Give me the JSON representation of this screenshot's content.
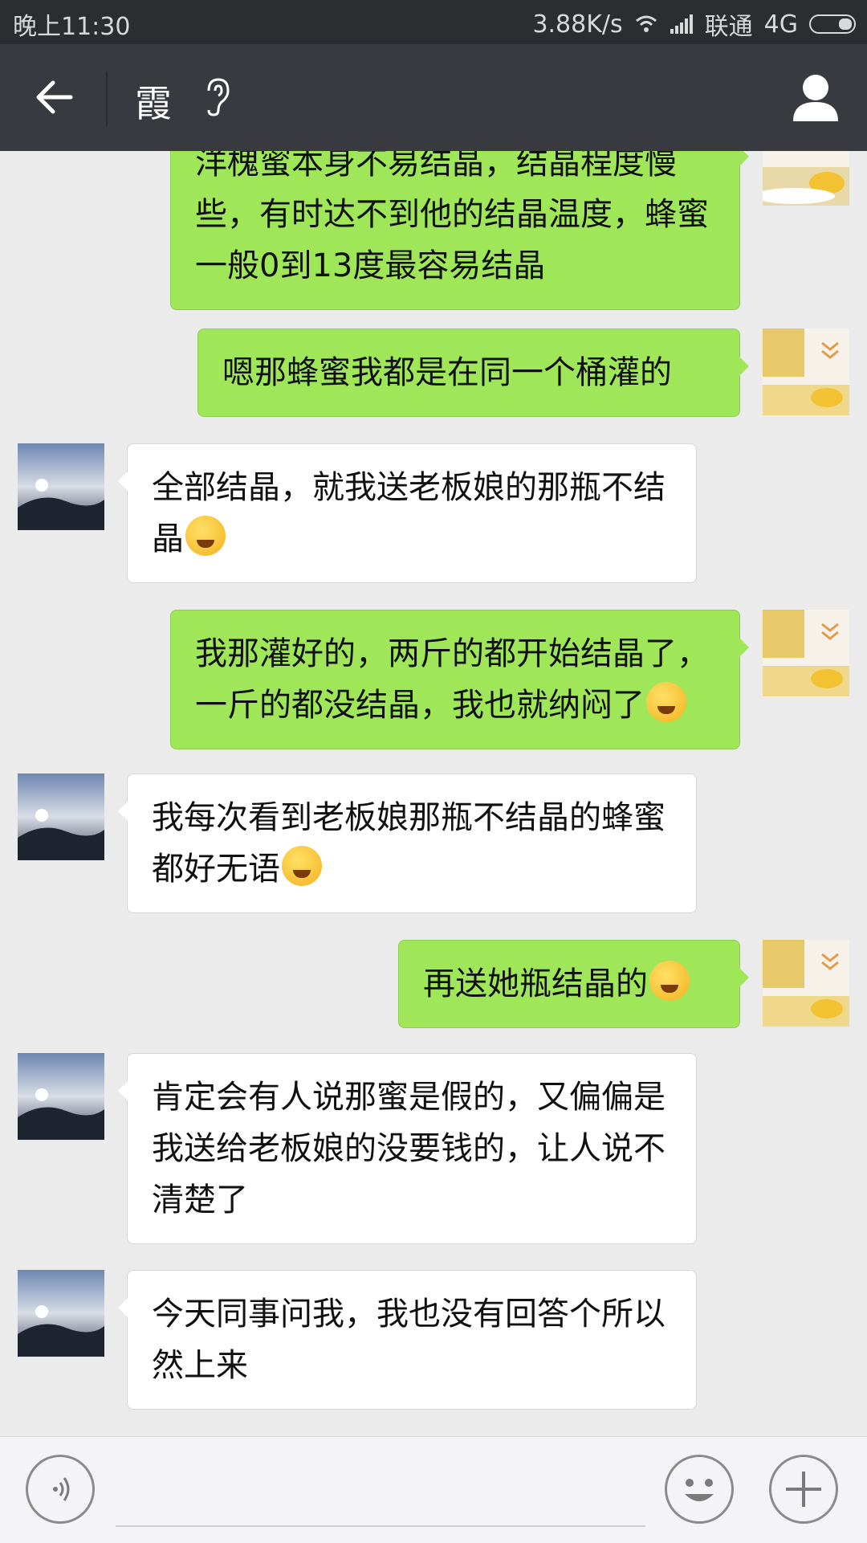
{
  "status_bar": {
    "time": "晚上11:30",
    "net_speed": "3.88K/s",
    "carrier": "联通",
    "network": "4G"
  },
  "header": {
    "title": "霞",
    "back_icon": "back-arrow-icon",
    "ear_icon": "ear-icon",
    "contact_icon": "person-icon"
  },
  "messages": [
    {
      "sender": "me",
      "text": "洋槐蜜本身不易结晶，结晶程度慢些，有时达不到他的结晶温度，蜂蜜一般0到13度最容易结晶"
    },
    {
      "sender": "me",
      "text": "嗯那蜂蜜我都是在同一个桶灌的"
    },
    {
      "sender": "them",
      "text": "全部结晶，就我送老板娘的那瓶不结晶",
      "emoji": "laugh-cry"
    },
    {
      "sender": "me",
      "text": "我那灌好的，两斤的都开始结晶了，一斤的都没结晶，我也就纳闷了",
      "emoji": "laugh-cry"
    },
    {
      "sender": "them",
      "text": "我每次看到老板娘那瓶不结晶的蜂蜜都好无语",
      "emoji": "sweat"
    },
    {
      "sender": "me",
      "text": "再送她瓶结晶的",
      "emoji": "grin"
    },
    {
      "sender": "them",
      "text": "肯定会有人说那蜜是假的，又偏偏是我送给老板娘的没要钱的，让人说不清楚了"
    },
    {
      "sender": "them",
      "text": "今天同事问我，我也没有回答个所以然上来"
    }
  ],
  "input_bar": {
    "voice_icon": "voice-icon",
    "emoji_icon": "smiley-icon",
    "plus_icon": "plus-icon"
  },
  "colors": {
    "my_bubble": "#9fe659",
    "their_bubble": "#ffffff",
    "background": "#ebebeb",
    "header": "#393a3f"
  }
}
